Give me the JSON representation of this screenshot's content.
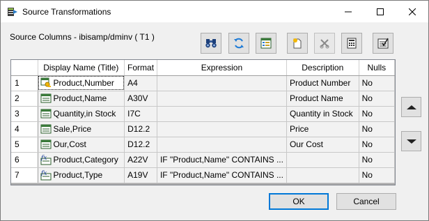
{
  "window": {
    "title": "Source Transformations"
  },
  "source_label": "Source Columns - ibisamp/dminv ( T1 )",
  "toolbar": {
    "group1": [
      {
        "icon": "binoculars-icon",
        "name": "find-button"
      },
      {
        "icon": "refresh-icon",
        "name": "refresh-button"
      },
      {
        "icon": "properties-icon",
        "name": "properties-button"
      }
    ],
    "group2": [
      {
        "icon": "new-icon",
        "name": "new-button"
      },
      {
        "icon": "delete-icon",
        "name": "delete-button"
      },
      {
        "icon": "calculator-icon",
        "name": "calculator-button"
      },
      {
        "icon": "checklist-icon",
        "name": "checklist-button"
      }
    ]
  },
  "table": {
    "headers": [
      "Display Name (Title)",
      "Format",
      "Expression",
      "Description",
      "Nulls"
    ],
    "rows": [
      {
        "num": "1",
        "icon": "key-icon",
        "name": "Product,Number",
        "format": "A4",
        "expression": "",
        "description": "Product Number",
        "nulls": "No"
      },
      {
        "num": "2",
        "icon": "column-icon",
        "name": "Product,Name",
        "format": "A30V",
        "expression": "",
        "description": "Product Name",
        "nulls": "No"
      },
      {
        "num": "3",
        "icon": "column-icon",
        "name": "Quantity,in Stock",
        "format": "I7C",
        "expression": "",
        "description": "Quantity in Stock",
        "nulls": "No"
      },
      {
        "num": "4",
        "icon": "column-icon",
        "name": "Sale,Price",
        "format": "D12.2",
        "expression": "",
        "description": "Price",
        "nulls": "No"
      },
      {
        "num": "5",
        "icon": "column-icon",
        "name": "Our,Cost",
        "format": "D12.2",
        "expression": "",
        "description": "Our Cost",
        "nulls": "No"
      },
      {
        "num": "6",
        "icon": "fx-icon",
        "name": "Product,Category",
        "format": "A22V",
        "expression": "IF \"Product,Name\" CONTAINS ...",
        "description": "",
        "nulls": "No"
      },
      {
        "num": "7",
        "icon": "fx-icon",
        "name": "Product,Type",
        "format": "A19V",
        "expression": "IF \"Product,Name\" CONTAINS ...",
        "description": "",
        "nulls": "No"
      }
    ]
  },
  "side_buttons": {
    "up_icon": "move-up-icon",
    "down_icon": "move-down-icon"
  },
  "buttons": {
    "ok": "OK",
    "cancel": "Cancel"
  },
  "colors": {
    "accent": "#0078d7",
    "grid_bg": "#ababab",
    "cell_bg": "#f2f2f2"
  }
}
